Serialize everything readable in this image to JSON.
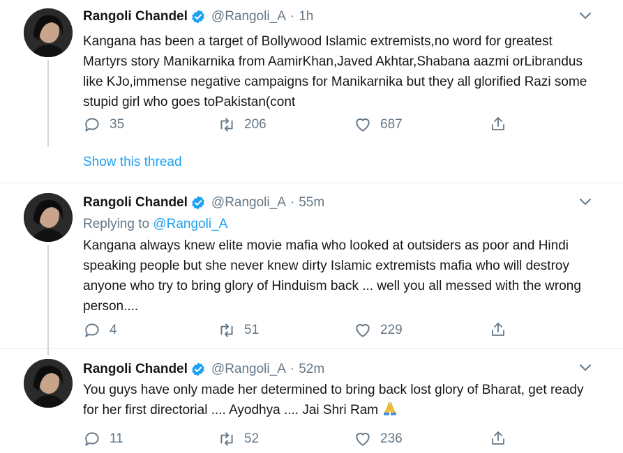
{
  "tweets": [
    {
      "name": "Rangoli Chandel",
      "handle": "@Rangoli_A",
      "separator": "·",
      "time": "1h",
      "text": "Kangana has been a target of Bollywood Islamic extremists,no word for greatest Martyrs story Manikarnika from AamirKhan,Javed Akhtar,Shabana aazmi orLibrandus like KJo,immense negative campaigns for Manikarnika but they all glorified Razi some stupid girl who goes toPakistan(cont",
      "replies": "35",
      "retweets": "206",
      "likes": "687"
    },
    {
      "name": "Rangoli Chandel",
      "handle": "@Rangoli_A",
      "separator": "·",
      "time": "55m",
      "replying_label": "Replying to",
      "replying_to": "@Rangoli_A",
      "text": "Kangana always knew elite movie mafia who looked at outsiders as poor and Hindi speaking people but she never knew dirty Islamic extremists mafia who will destroy anyone who try to bring glory of Hinduism back ... well you all messed with the wrong person....",
      "replies": "4",
      "retweets": "51",
      "likes": "229"
    },
    {
      "name": "Rangoli Chandel",
      "handle": "@Rangoli_A",
      "separator": "·",
      "time": "52m",
      "text": "You guys have only made her determined to bring back lost glory of Bharat, get ready for her first directorial .... Ayodhya .... Jai Shri Ram",
      "replies": "11",
      "retweets": "52",
      "likes": "236"
    }
  ],
  "show_thread": "Show this thread",
  "icons": {
    "verified": "verified-badge-icon",
    "caret": "chevron-down-icon",
    "reply": "reply-icon",
    "retweet": "retweet-icon",
    "like": "heart-icon",
    "share": "share-icon",
    "emoji": "folded-hands-emoji"
  },
  "colors": {
    "accent": "#1da1f2",
    "muted": "#657786",
    "text": "#14171a"
  }
}
